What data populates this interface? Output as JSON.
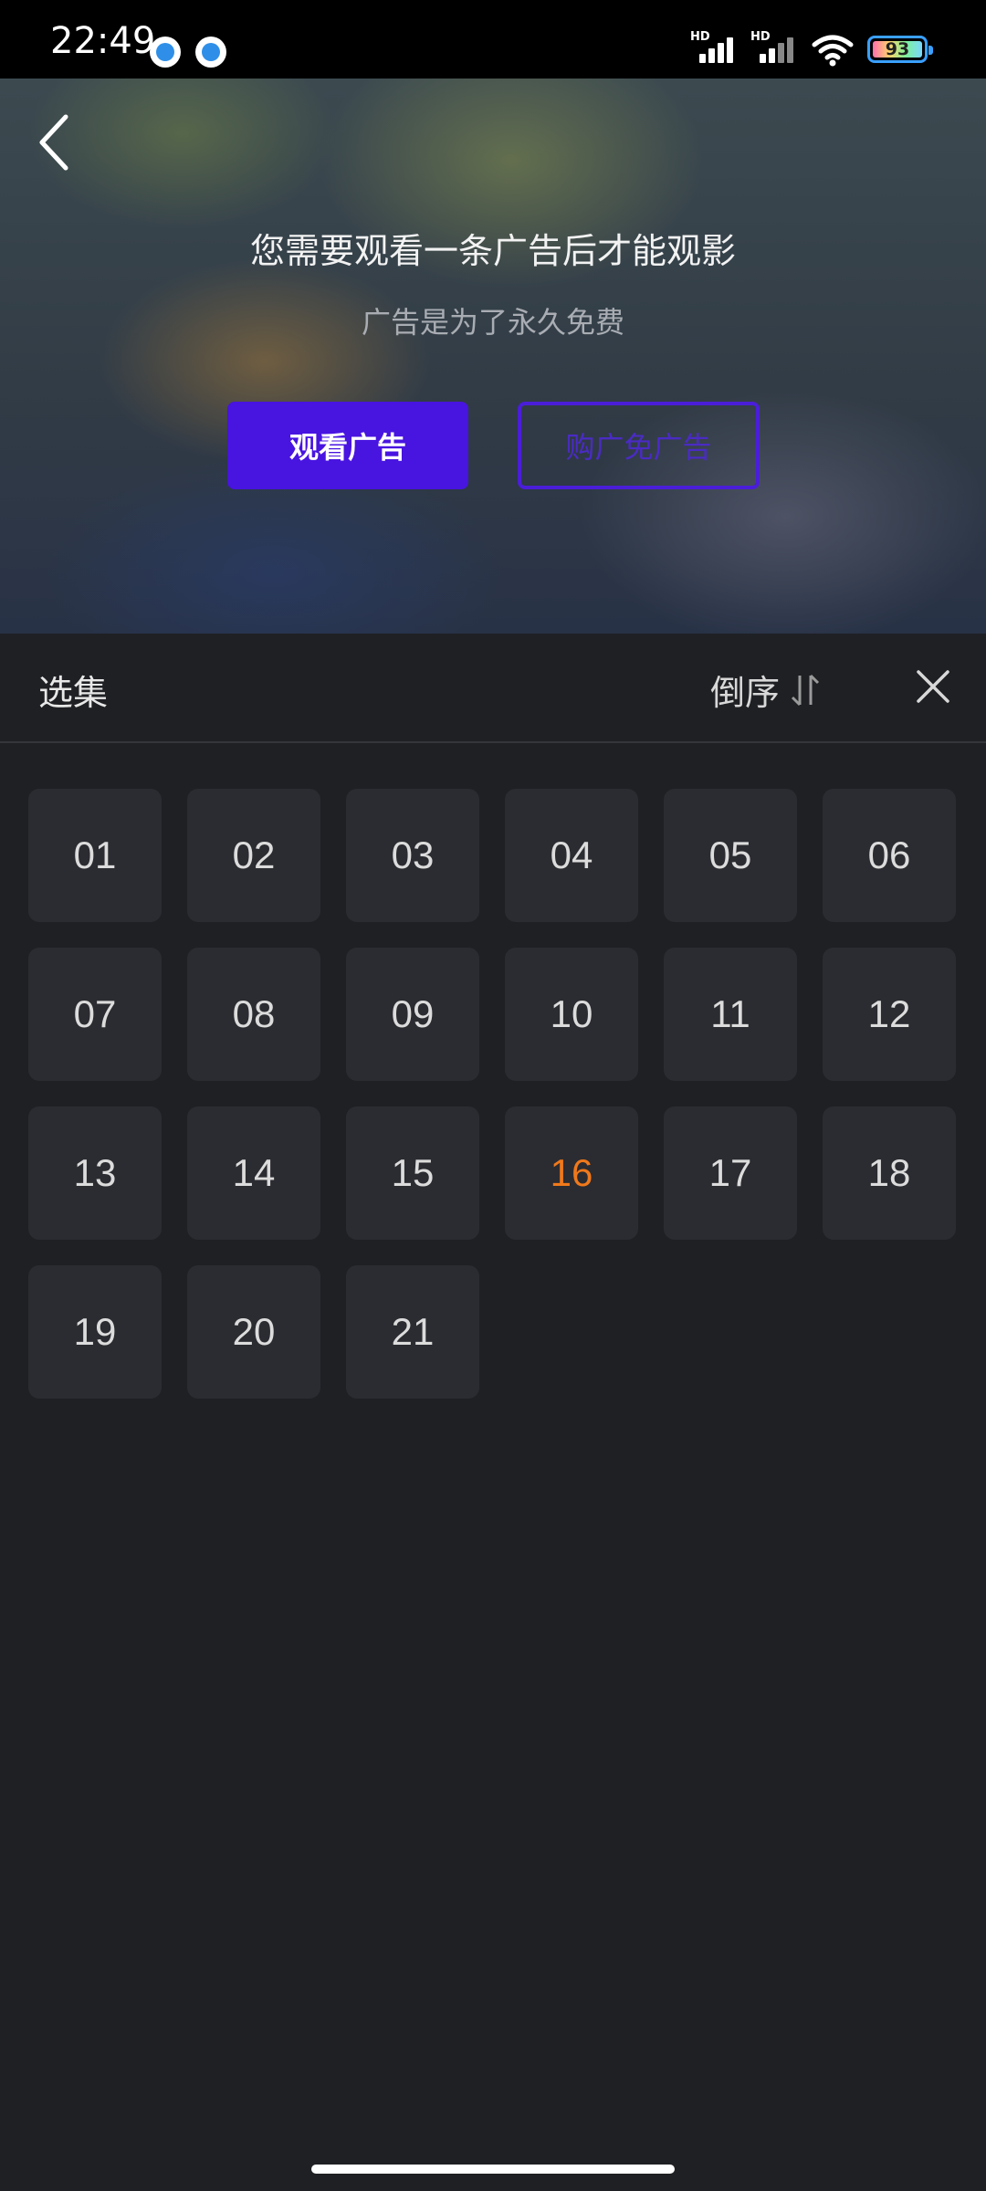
{
  "status_bar": {
    "time": "22:49",
    "battery_level": "93",
    "signal1_label": "HD",
    "signal2_label": "HD"
  },
  "player": {
    "notice_title": "您需要观看一条广告后才能观影",
    "notice_subtitle": "广告是为了永久免费",
    "watch_ad_label": "观看广告",
    "vip_label": "购广免广告"
  },
  "panel": {
    "title": "选集",
    "sort_label": "倒序",
    "episodes": [
      "01",
      "02",
      "03",
      "04",
      "05",
      "06",
      "07",
      "08",
      "09",
      "10",
      "11",
      "12",
      "13",
      "14",
      "15",
      "16",
      "17",
      "18",
      "19",
      "20",
      "21"
    ],
    "current_episode": "16"
  },
  "colors": {
    "accent": "#4814e0",
    "current_episode": "#f0791b",
    "panel_bg": "#1f2024",
    "tile_bg": "#2b2c31"
  }
}
